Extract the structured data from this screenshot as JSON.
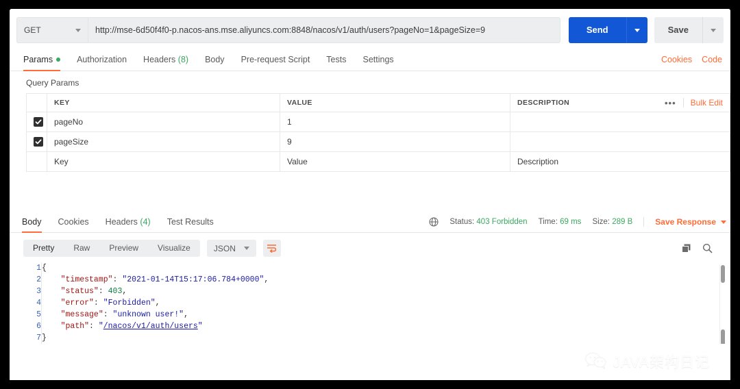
{
  "request": {
    "method": "GET",
    "url": "http://mse-6d50f4f0-p.nacos-ans.mse.aliyuncs.com:8848/nacos/v1/auth/users?pageNo=1&pageSize=9",
    "send_label": "Send",
    "save_label": "Save",
    "tabs": [
      {
        "label": "Params",
        "badge": "",
        "dot": true,
        "active": true
      },
      {
        "label": "Authorization",
        "badge": "",
        "dot": false,
        "active": false
      },
      {
        "label": "Headers",
        "badge": "(8)",
        "dot": false,
        "active": false
      },
      {
        "label": "Body",
        "badge": "",
        "dot": false,
        "active": false
      },
      {
        "label": "Pre-request Script",
        "badge": "",
        "dot": false,
        "active": false
      },
      {
        "label": "Tests",
        "badge": "",
        "dot": false,
        "active": false
      },
      {
        "label": "Settings",
        "badge": "",
        "dot": false,
        "active": false
      }
    ],
    "links": [
      {
        "label": "Cookies"
      },
      {
        "label": "Code"
      }
    ]
  },
  "params": {
    "section_label": "Query Params",
    "headers": {
      "key": "KEY",
      "value": "VALUE",
      "description": "DESCRIPTION"
    },
    "bulk_edit_label": "Bulk Edit",
    "more_icon": "•••",
    "rows": [
      {
        "checked": true,
        "key": "pageNo",
        "value": "1",
        "description": ""
      },
      {
        "checked": true,
        "key": "pageSize",
        "value": "9",
        "description": ""
      }
    ],
    "new_row": {
      "key_placeholder": "Key",
      "value_placeholder": "Value",
      "description_placeholder": "Description"
    }
  },
  "response": {
    "tabs": [
      {
        "label": "Body",
        "badge": "",
        "active": true
      },
      {
        "label": "Cookies",
        "badge": "",
        "active": false
      },
      {
        "label": "Headers",
        "badge": "(4)",
        "active": false
      },
      {
        "label": "Test Results",
        "badge": "",
        "active": false
      }
    ],
    "meta": {
      "status_label": "Status:",
      "status_value": "403 Forbidden",
      "time_label": "Time:",
      "time_value": "69 ms",
      "size_label": "Size:",
      "size_value": "289 B"
    },
    "save_response_label": "Save Response",
    "view_modes": [
      {
        "label": "Pretty",
        "active": true
      },
      {
        "label": "Raw",
        "active": false
      },
      {
        "label": "Preview",
        "active": false
      },
      {
        "label": "Visualize",
        "active": false
      }
    ],
    "format": "JSON",
    "body_lines": [
      {
        "n": "1",
        "segments": [
          {
            "t": "{",
            "c": "brace"
          }
        ]
      },
      {
        "n": "2",
        "segments": [
          {
            "t": "    ",
            "c": "p"
          },
          {
            "t": "\"timestamp\"",
            "c": "k"
          },
          {
            "t": ": ",
            "c": "p"
          },
          {
            "t": "\"2021-01-14T15:17:06.784+0000\"",
            "c": "s"
          },
          {
            "t": ",",
            "c": "p"
          }
        ]
      },
      {
        "n": "3",
        "segments": [
          {
            "t": "    ",
            "c": "p"
          },
          {
            "t": "\"status\"",
            "c": "k"
          },
          {
            "t": ": ",
            "c": "p"
          },
          {
            "t": "403",
            "c": "n"
          },
          {
            "t": ",",
            "c": "p"
          }
        ]
      },
      {
        "n": "4",
        "segments": [
          {
            "t": "    ",
            "c": "p"
          },
          {
            "t": "\"error\"",
            "c": "k"
          },
          {
            "t": ": ",
            "c": "p"
          },
          {
            "t": "\"Forbidden\"",
            "c": "s"
          },
          {
            "t": ",",
            "c": "p"
          }
        ]
      },
      {
        "n": "5",
        "segments": [
          {
            "t": "    ",
            "c": "p"
          },
          {
            "t": "\"message\"",
            "c": "k"
          },
          {
            "t": ": ",
            "c": "p"
          },
          {
            "t": "\"unknown user!\"",
            "c": "s"
          },
          {
            "t": ",",
            "c": "p"
          }
        ]
      },
      {
        "n": "6",
        "segments": [
          {
            "t": "    ",
            "c": "p"
          },
          {
            "t": "\"path\"",
            "c": "k"
          },
          {
            "t": ": ",
            "c": "p"
          },
          {
            "t": "\"",
            "c": "s"
          },
          {
            "t": "/nacos/v1/auth/users",
            "c": "link-s"
          },
          {
            "t": "\"",
            "c": "s"
          }
        ]
      },
      {
        "n": "7",
        "segments": [
          {
            "t": "}",
            "c": "brace"
          }
        ]
      }
    ]
  },
  "watermark": {
    "text": "JAVA架构日记"
  },
  "colors": {
    "accent_orange": "#ff6c37",
    "send_blue": "#1257d6",
    "status_green": "#3aa95f"
  }
}
